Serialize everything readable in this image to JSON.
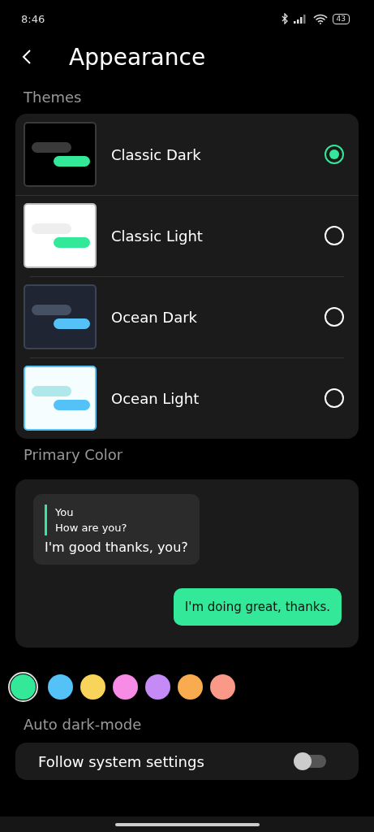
{
  "status_bar": {
    "time": "8:46",
    "battery": "43"
  },
  "header": {
    "title": "Appearance"
  },
  "themes": {
    "heading": "Themes",
    "items": [
      {
        "label": "Classic Dark",
        "kind": "classicdark",
        "selected": true
      },
      {
        "label": "Classic Light",
        "kind": "classiclight",
        "selected": false
      },
      {
        "label": "Ocean Dark",
        "kind": "oceandark",
        "selected": false
      },
      {
        "label": "Ocean Light",
        "kind": "oceanlight",
        "selected": false
      }
    ]
  },
  "primary_color": {
    "heading": "Primary Color",
    "preview": {
      "quote_author": "You",
      "quote_text": "How are you?",
      "incoming": "I'm good thanks, you?",
      "outgoing": "I'm doing great, thanks."
    },
    "swatches": [
      {
        "color": "#34e89a",
        "selected": true
      },
      {
        "color": "#54c2f7",
        "selected": false
      },
      {
        "color": "#f8d55a",
        "selected": false
      },
      {
        "color": "#f78ce6",
        "selected": false
      },
      {
        "color": "#c48bf7",
        "selected": false
      },
      {
        "color": "#f9ab50",
        "selected": false
      },
      {
        "color": "#fa9987",
        "selected": false
      }
    ]
  },
  "auto_dark": {
    "heading": "Auto dark-mode",
    "toggle": {
      "label": "Follow system settings",
      "on": false
    }
  }
}
